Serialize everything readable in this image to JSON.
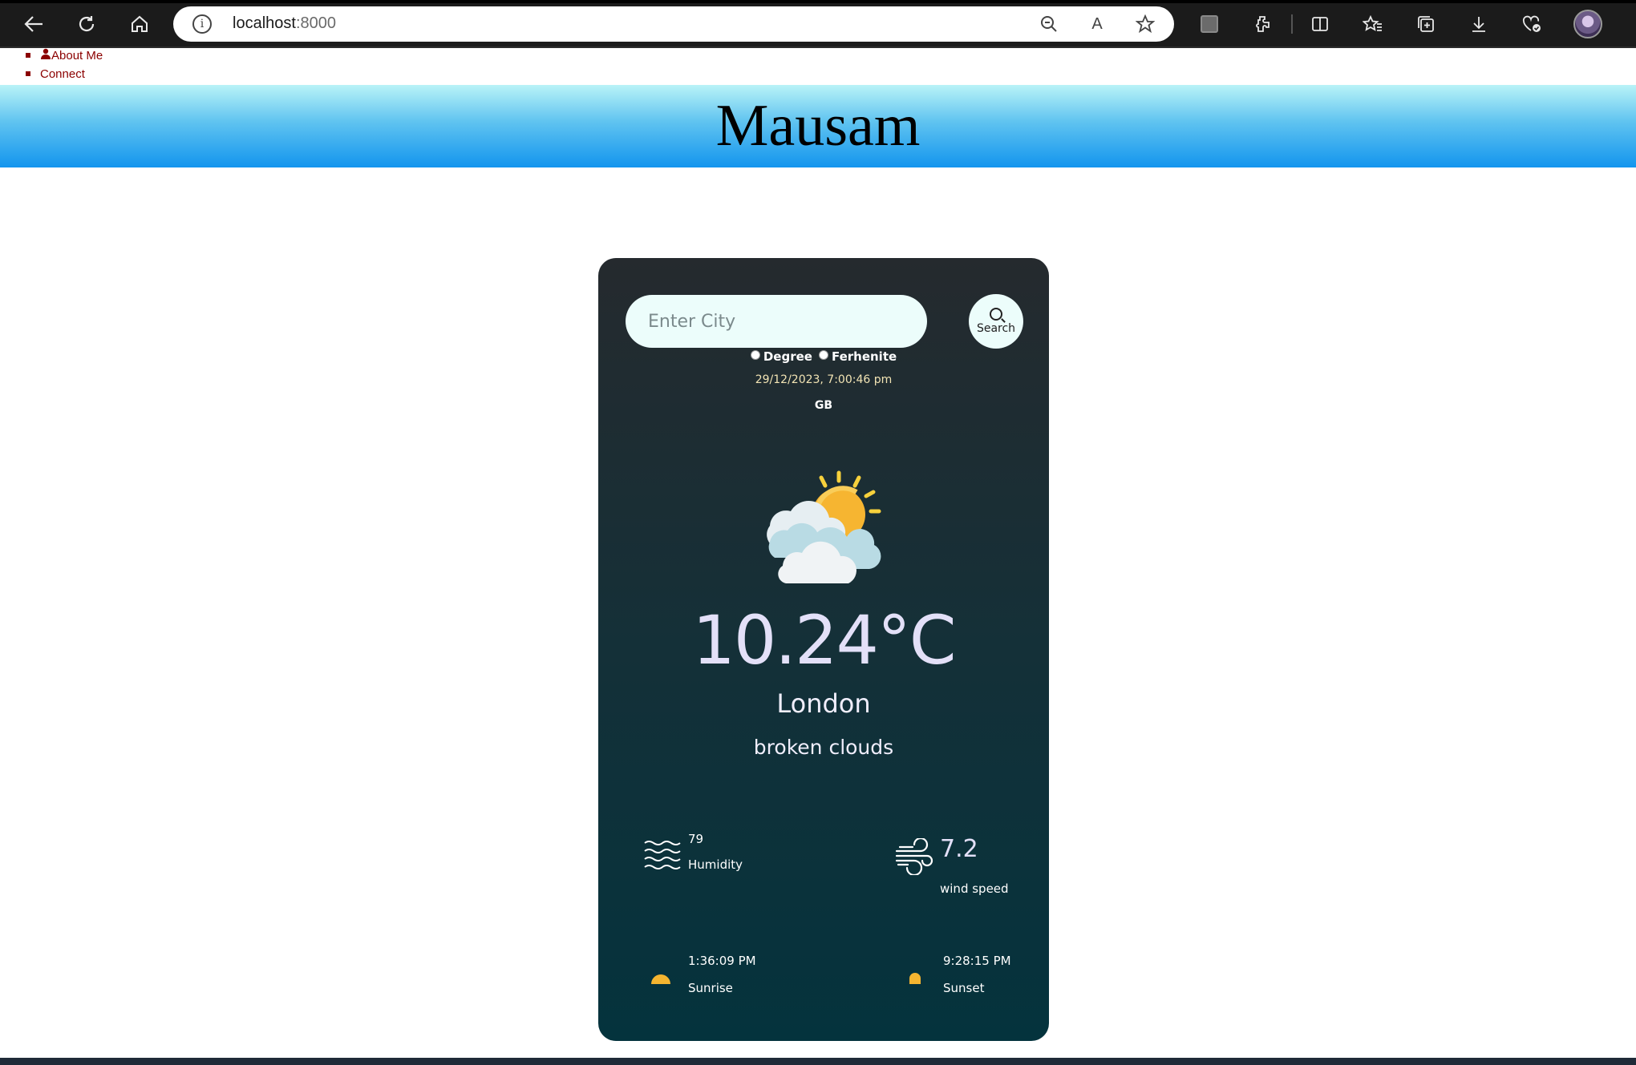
{
  "browser": {
    "url_host": "localhost",
    "url_port": ":8000",
    "read_aloud_label": "A"
  },
  "nav": {
    "items": [
      "About Me",
      "Connect"
    ]
  },
  "header": {
    "title": "Mausam"
  },
  "weather": {
    "search_placeholder": "Enter City",
    "search_button": "Search",
    "unit_degree": "Degree",
    "unit_fahrenheit": "Ferhenite",
    "datetime": "29/12/2023, 7:00:46 pm",
    "country": "GB",
    "temperature": "10.24°C",
    "city": "London",
    "description": "broken clouds",
    "humidity_value": "79",
    "humidity_label": "Humidity",
    "wind_value": "7.2",
    "wind_label": "wind speed",
    "sunrise_value": "1:36:09 PM",
    "sunrise_label": "Sunrise",
    "sunset_value": "9:28:15 PM",
    "sunset_label": "Sunset"
  },
  "colors": {
    "banner_top": "#b9f3f7",
    "banner_bottom": "#1395ee",
    "card_top": "#252a2e",
    "card_bottom": "#04333d",
    "nav_link": "#8b0000",
    "sun": "#f5b530"
  }
}
